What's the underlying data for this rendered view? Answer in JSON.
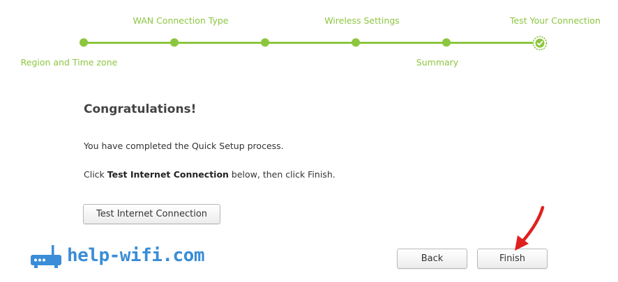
{
  "stepper": {
    "steps": [
      {
        "label": "Region and Time zone",
        "position": "bottom"
      },
      {
        "label": "WAN Connection Type",
        "position": "top"
      },
      {
        "label": "",
        "position": "none"
      },
      {
        "label": "Wireless Settings",
        "position": "top"
      },
      {
        "label": "Summary",
        "position": "bottom"
      },
      {
        "label": "Test Your Connection",
        "position": "top",
        "completed": true
      }
    ],
    "accent_color": "#8cc63f"
  },
  "content": {
    "title": "Congratulations!",
    "line1": "You have completed the Quick Setup process.",
    "line2_prefix": "Click ",
    "line2_bold": "Test Internet Connection",
    "line2_suffix": " below, then click Finish."
  },
  "buttons": {
    "test_label": "Test Internet Connection",
    "back_label": "Back",
    "finish_label": "Finish"
  },
  "watermark": {
    "text": "help-wifi.com",
    "color": "#3a8dd6",
    "icon": "router-icon"
  },
  "annotation": {
    "icon": "red-arrow-icon",
    "color": "#e02020"
  }
}
